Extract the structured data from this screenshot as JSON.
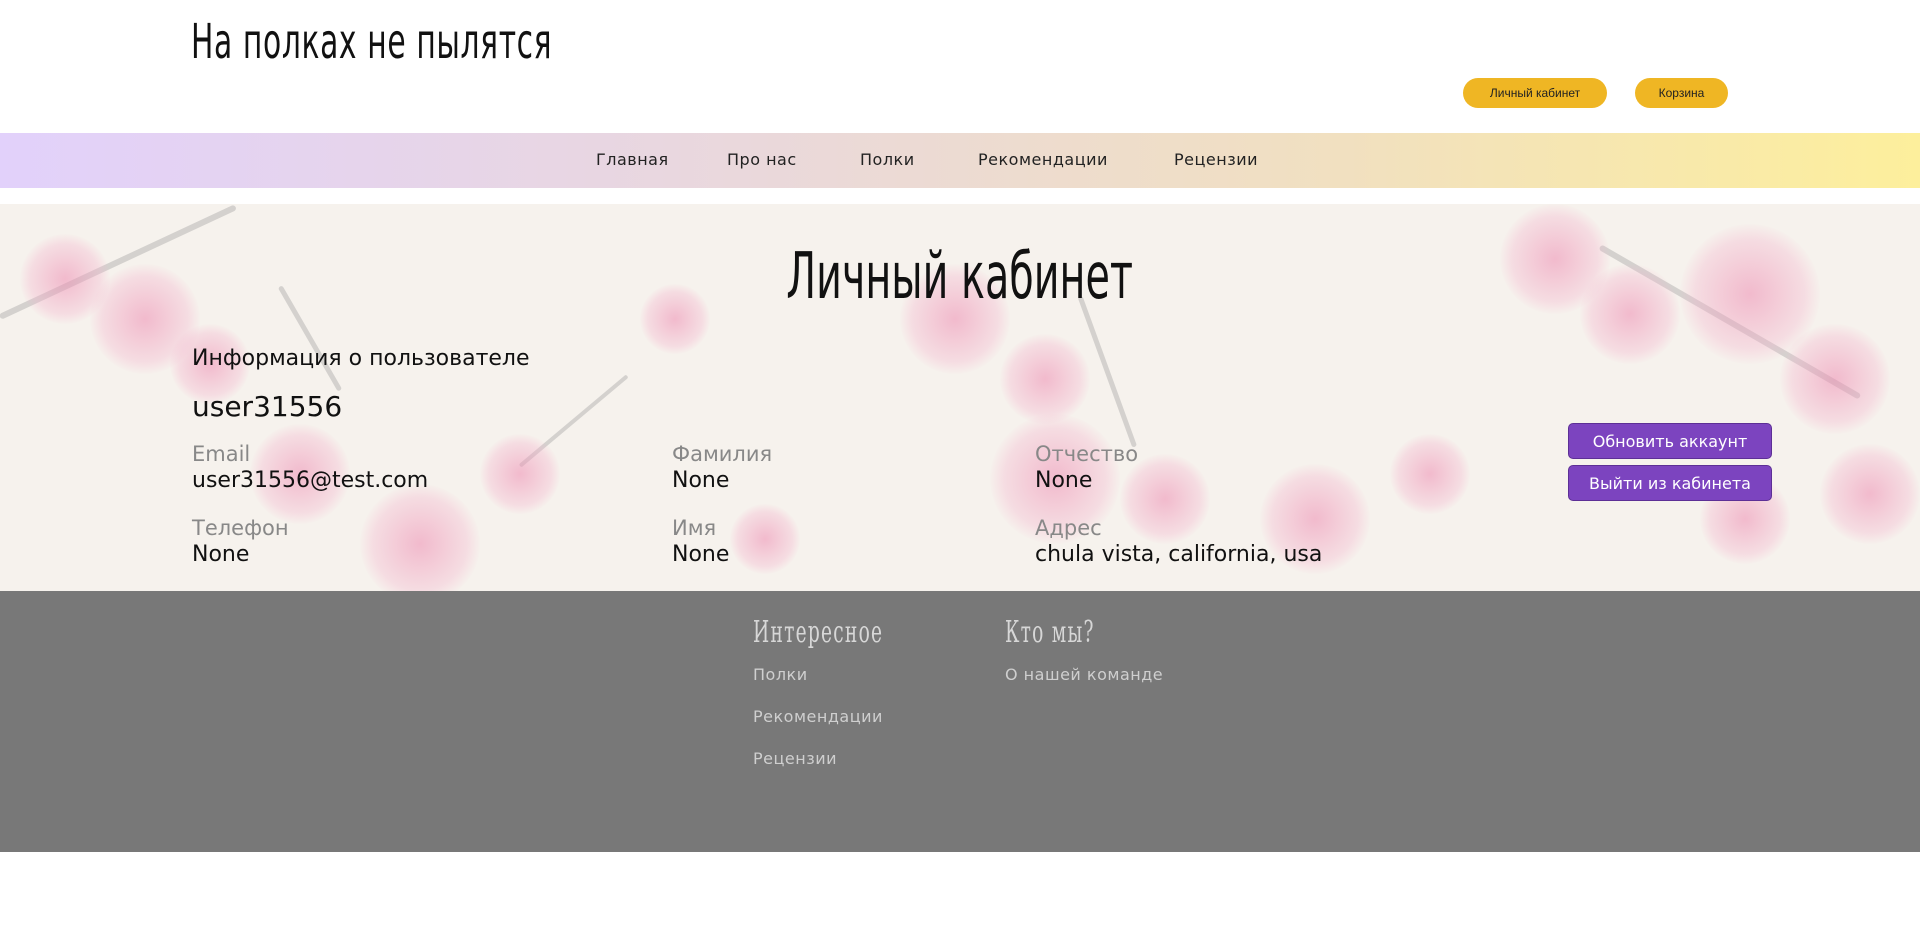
{
  "header": {
    "site_title": "На полках не пылятся",
    "account_button": "Личный кабинет",
    "cart_button": "Корзина"
  },
  "nav": {
    "items": [
      "Главная",
      "Про нас",
      "Полки",
      "Рекомендации",
      "Рецензии"
    ]
  },
  "main": {
    "heading": "Личный кабинет",
    "section_title": "Информация о пользователе",
    "username": "user31556",
    "fields": {
      "email": {
        "label": "Email",
        "value": "user31556@test.com"
      },
      "phone": {
        "label": "Телефон",
        "value": "None"
      },
      "last_name": {
        "label": "Фамилия",
        "value": "None"
      },
      "first_name": {
        "label": "Имя",
        "value": "None"
      },
      "patronymic": {
        "label": "Отчество",
        "value": "None"
      },
      "address": {
        "label": "Адрес",
        "value": "chula vista, california, usa"
      }
    },
    "update_button": "Обновить аккаунт",
    "logout_button": "Выйти из кабинета"
  },
  "footer": {
    "col1_heading": "Интересное",
    "col1_links": [
      "Полки",
      "Рекомендации",
      "Рецензии"
    ],
    "col2_heading": "Кто мы?",
    "col2_links": [
      "О нашей команде"
    ]
  },
  "colors": {
    "accent_yellow": "#efb624",
    "accent_purple": "#7c44bf",
    "footer_bg": "#787878"
  }
}
